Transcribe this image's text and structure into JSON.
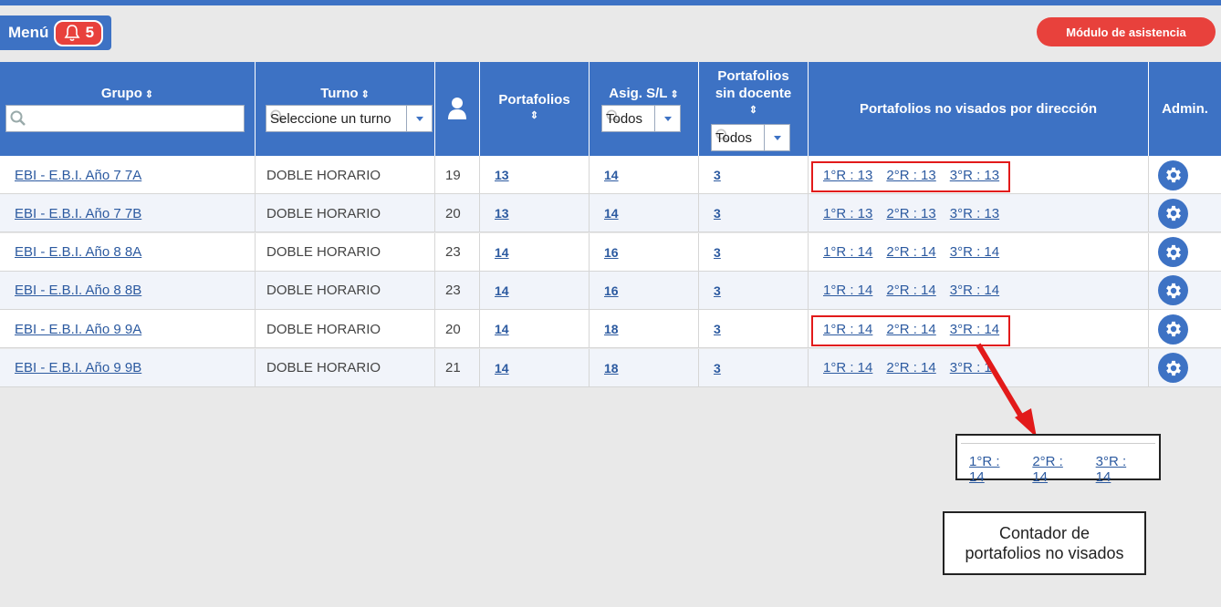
{
  "menu": {
    "label": "Menú",
    "notifications": "5"
  },
  "modulo_button": "Módulo de asistencia",
  "headers": {
    "grupo": "Grupo",
    "turno": "Turno",
    "turno_select": "Seleccione un turno",
    "portafolios": "Portafolios",
    "asig": "Asig. S/L",
    "asig_select": "Todos",
    "sin_docente_1": "Portafolios",
    "sin_docente_2": "sin docente",
    "sin_docente_select": "Todos",
    "no_visados": "Portafolios no visados por dirección",
    "admin": "Admin."
  },
  "rows": [
    {
      "grupo": "EBI - E.B.I. Año 7 7A",
      "turno": "DOBLE HORARIO",
      "alumnos": "19",
      "portafolios": "13",
      "asig": "14",
      "sin_docente": "3",
      "r1": "1°R : 13",
      "r2": "2°R : 13",
      "r3": "3°R : 13"
    },
    {
      "grupo": "EBI - E.B.I. Año 7 7B",
      "turno": "DOBLE HORARIO",
      "alumnos": "20",
      "portafolios": "13",
      "asig": "14",
      "sin_docente": "3",
      "r1": "1°R : 13",
      "r2": "2°R : 13",
      "r3": "3°R : 13"
    },
    {
      "grupo": "EBI - E.B.I. Año 8 8A",
      "turno": "DOBLE HORARIO",
      "alumnos": "23",
      "portafolios": "14",
      "asig": "16",
      "sin_docente": "3",
      "r1": "1°R : 14",
      "r2": "2°R : 14",
      "r3": "3°R : 14"
    },
    {
      "grupo": "EBI - E.B.I. Año 8 8B",
      "turno": "DOBLE HORARIO",
      "alumnos": "23",
      "portafolios": "14",
      "asig": "16",
      "sin_docente": "3",
      "r1": "1°R : 14",
      "r2": "2°R : 14",
      "r3": "3°R : 14"
    },
    {
      "grupo": "EBI - E.B.I. Año 9 9A",
      "turno": "DOBLE HORARIO",
      "alumnos": "20",
      "portafolios": "14",
      "asig": "18",
      "sin_docente": "3",
      "r1": "1°R : 14",
      "r2": "2°R : 14",
      "r3": "3°R : 14"
    },
    {
      "grupo": "EBI - E.B.I. Año 9 9B",
      "turno": "DOBLE HORARIO",
      "alumnos": "21",
      "portafolios": "14",
      "asig": "18",
      "sin_docente": "3",
      "r1": "1°R : 14",
      "r2": "2°R : 14",
      "r3": "3°R : 1"
    }
  ],
  "zoom": {
    "r1": "1°R : 14",
    "r2": "2°R : 14",
    "r3": "3°R : 14"
  },
  "callout": {
    "line1": "Contador de",
    "line2": "portafolios no visados"
  },
  "colors": {
    "primary": "#3d72c4",
    "accent_red": "#e8413c",
    "annotation_red": "#e21a1a"
  }
}
